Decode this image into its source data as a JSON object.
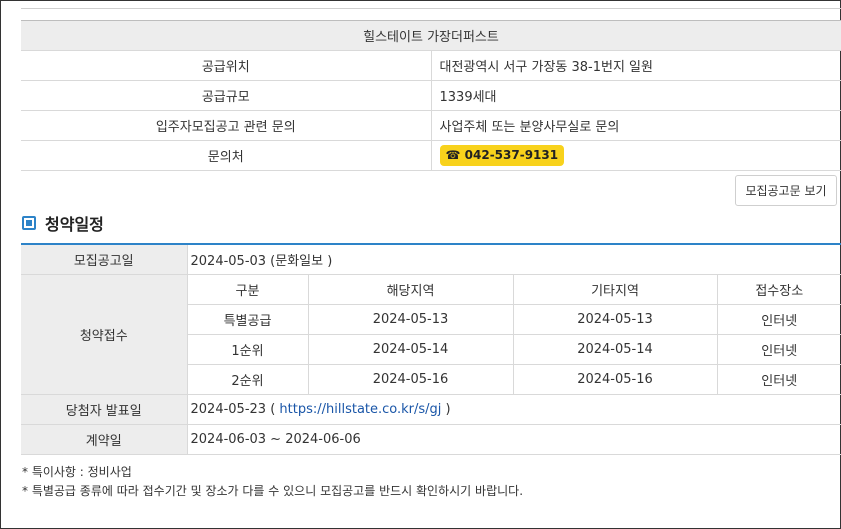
{
  "info": {
    "title": "힐스테이트 가장더퍼스트",
    "rows": [
      {
        "label": "공급위치",
        "value": "대전광역시 서구 가장동 38-1번지 일원"
      },
      {
        "label": "공급규모",
        "value": "1339세대"
      },
      {
        "label": "입주자모집공고 관련 문의",
        "value": "사업주체 또는 분양사무실로 문의"
      },
      {
        "label": "문의처",
        "value": "042-537-9131"
      }
    ],
    "phone_icon": "☎",
    "notice_button": "모집공고문 보기"
  },
  "schedule": {
    "title": "청약일정",
    "announce": {
      "label": "모집공고일",
      "value": "2024-05-03 (문화일보 )"
    },
    "receipt_label": "청약접수",
    "columns": [
      "구분",
      "해당지역",
      "기타지역",
      "접수장소"
    ],
    "rows": [
      [
        "특별공급",
        "2024-05-13",
        "2024-05-13",
        "인터넷"
      ],
      [
        "1순위",
        "2024-05-14",
        "2024-05-14",
        "인터넷"
      ],
      [
        "2순위",
        "2024-05-16",
        "2024-05-16",
        "인터넷"
      ]
    ],
    "winner": {
      "label": "당첨자 발표일",
      "date": "2024-05-23",
      "open": " ( ",
      "url": "https://hillstate.co.kr/s/gj",
      "close": " )"
    },
    "contract": {
      "label": "계약일",
      "value": "2024-06-03 ~ 2024-06-06"
    }
  },
  "notes": [
    "* 특이사항 : 정비사업",
    "* 특별공급 종류에 따라 접수기간 및 장소가 다를 수 있으니 모집공고를 반드시 확인하시기 바랍니다."
  ],
  "colors": {
    "accent": "#2d83c8",
    "phone_badge": "#f8d21c",
    "link": "#1a56a8"
  }
}
